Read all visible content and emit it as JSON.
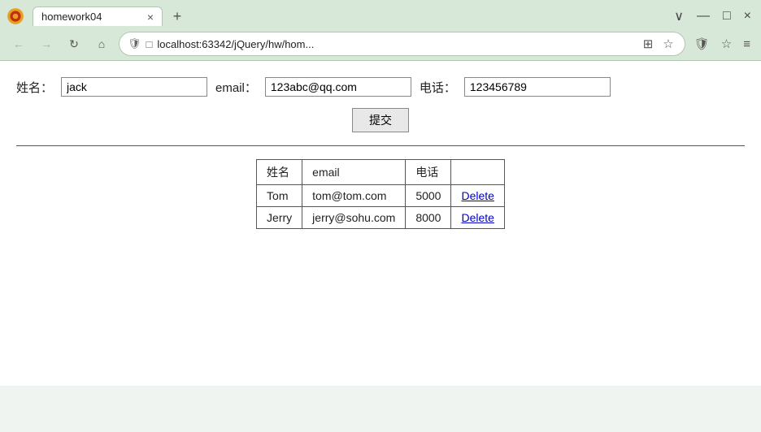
{
  "browser": {
    "tab_title": "homework04",
    "tab_close": "×",
    "new_tab": "+",
    "chevron_down": "∨",
    "minimize": "—",
    "maximize": "□",
    "close_window": "×",
    "back": "←",
    "forward": "→",
    "refresh": "↻",
    "home": "⌂",
    "address": "localhost:63342/jQuery/hw/hom...",
    "shield": "🛡",
    "page_icon": "□",
    "qr": "⊞",
    "star": "☆",
    "shield2": "🛡",
    "more_tools": "☆",
    "menu": "≡"
  },
  "form": {
    "name_label": "姓名：",
    "name_value": "jack",
    "email_label": "email：",
    "email_value": "123abc@qq.com",
    "phone_label": "电话：",
    "phone_value": "123456789",
    "submit_label": "提交"
  },
  "table": {
    "headers": [
      "姓名",
      "email",
      "电话",
      ""
    ],
    "rows": [
      {
        "name": "Tom",
        "email": "tom@tom.com",
        "phone": "5000",
        "action": "Delete"
      },
      {
        "name": "Jerry",
        "email": "jerry@sohu.com",
        "phone": "8000",
        "action": "Delete"
      }
    ]
  }
}
